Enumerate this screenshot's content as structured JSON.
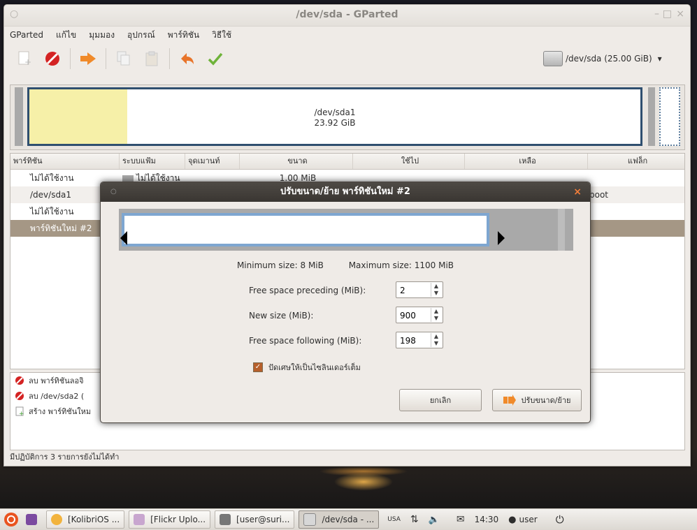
{
  "window": {
    "title": "/dev/sda - GParted",
    "menu": [
      "GParted",
      "แก้ไข",
      "มุมมอง",
      "อุปกรณ์",
      "พาร์ทิชัน",
      "วิธีใช้"
    ],
    "device": "/dev/sda  (25.00 GiB)"
  },
  "diskmap": {
    "partition_name": "/dev/sda1",
    "partition_size": "23.92 GiB"
  },
  "table": {
    "headers": [
      "พาร์ทิชัน",
      "ระบบแฟ้ม",
      "จุดเมานท์",
      "ขนาด",
      "ใช้ไป",
      "เหลือ",
      "แฟล็ก"
    ],
    "rows": [
      {
        "partition": "ไม่ได้ใช้งาน",
        "fs": "ไม่ได้ใช้งาน",
        "size": "1.00 MiB"
      },
      {
        "partition": "/dev/sda1",
        "flags": "boot"
      },
      {
        "partition": "ไม่ได้ใช้งาน"
      },
      {
        "partition": "พาร์ทิชันใหม่ #2"
      }
    ]
  },
  "operations": [
    {
      "icon": "delete-icon",
      "label": "ลบ พาร์ทิชันลอจิ"
    },
    {
      "icon": "delete-icon",
      "label": "ลบ /dev/sda2 ("
    },
    {
      "icon": "create-icon",
      "label": "สร้าง พาร์ทิชันใหม"
    }
  ],
  "status": "มีปฏิบัติการ 3 รายการยังไม่ได้ทำ",
  "dialog": {
    "title": "ปรับขนาด/ย้าย พาร์ทิชันใหม่ #2",
    "min_size": "Minimum size: 8 MiB",
    "max_size": "Maximum size: 1100 MiB",
    "fields": [
      {
        "label": "Free space preceding (MiB):",
        "value": "2"
      },
      {
        "label": "New size (MiB):",
        "value": "900"
      },
      {
        "label": "Free space following (MiB):",
        "value": "198"
      }
    ],
    "checkbox_label": "ปัดเศษให้เป็นไซลินเดอร์เต็ม",
    "checkbox_checked": true,
    "cancel_label": "ยกเลิก",
    "ok_label": "ปรับขนาด/ย้าย"
  },
  "taskbar": {
    "items": [
      "[KolibriOS ...",
      "[Flickr Uplo...",
      "[user@suri...",
      "/dev/sda - ..."
    ],
    "keyboard": "USA",
    "clock": "14:30",
    "user": "user"
  }
}
